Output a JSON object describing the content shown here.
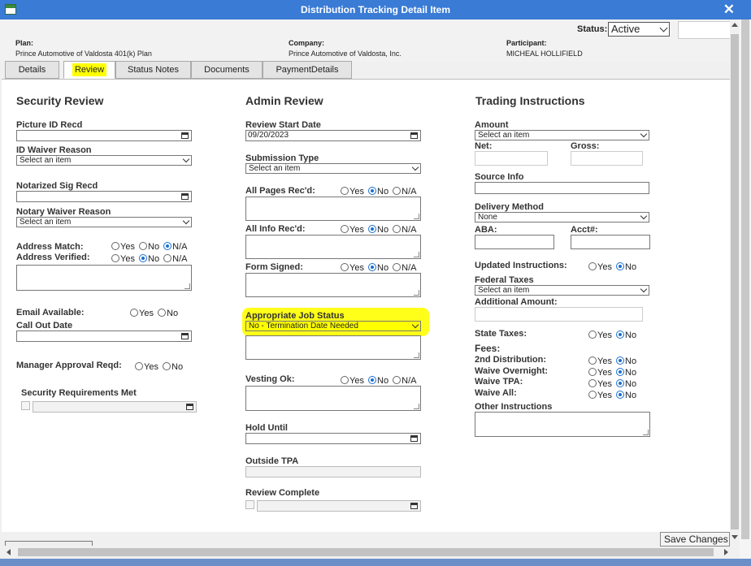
{
  "window": {
    "title": "Distribution Tracking Detail Item"
  },
  "header": {
    "plan_label": "Plan:",
    "plan_value": "Prince Automotive of Valdosta 401(k) Plan",
    "company_label": "Company:",
    "company_value": "Prince Automotive of Valdosta, Inc.",
    "participant_label": "Participant:",
    "participant_value": "MICHEAL HOLLIFIELD",
    "status_label": "Status:",
    "status_value": "Active"
  },
  "tabs": [
    {
      "label": "Details"
    },
    {
      "label": "Review"
    },
    {
      "label": "Status Notes"
    },
    {
      "label": "Documents"
    },
    {
      "label": "PaymentDetails"
    }
  ],
  "active_tab": "Review",
  "security": {
    "title": "Security Review",
    "picture_id_label": "Picture ID Recd",
    "id_waiver_label": "ID Waiver Reason",
    "id_waiver_value": "Select an item",
    "notarized_label": "Notarized Sig Recd",
    "notary_waiver_label": "Notary Waiver Reason",
    "notary_waiver_value": "Select an item",
    "address_match_label": "Address Match:",
    "address_verified_label": "Address Verified:",
    "email_label": "Email Available:",
    "callout_label": "Call Out Date",
    "manager_label": "Manager Approval Reqd:",
    "requirements_label": "Security Requirements Met"
  },
  "admin": {
    "title": "Admin Review",
    "review_start_label": "Review Start Date",
    "review_start_value": "09/20/2023",
    "submission_label": "Submission Type",
    "submission_value": "Select an item",
    "all_pages_label": "All Pages Rec'd:",
    "all_info_label": "All Info Rec'd:",
    "form_signed_label": "Form Signed:",
    "job_status_label": "Appropriate Job Status",
    "job_status_value": "No - Termination Date Needed",
    "vesting_label": "Vesting Ok:",
    "hold_until_label": "Hold Until",
    "outside_tpa_label": "Outside TPA",
    "review_complete_label": "Review Complete"
  },
  "trading": {
    "title": "Trading Instructions",
    "amount_label": "Amount",
    "amount_value": "Select an item",
    "net_label": "Net:",
    "gross_label": "Gross:",
    "source_label": "Source Info",
    "delivery_label": "Delivery Method",
    "delivery_value": "None",
    "aba_label": "ABA:",
    "acct_label": "Acct#:",
    "updated_label": "Updated Instructions:",
    "federal_label": "Federal Taxes",
    "federal_value": "Select an item",
    "additional_label": "Additional Amount:",
    "state_label": "State Taxes:",
    "fees_label": "Fees:",
    "second_dist_label": "2nd Distribution:",
    "waive_overnight_label": "Waive Overnight:",
    "waive_tpa_label": "Waive TPA:",
    "waive_all_label": "Waive All:",
    "other_label": "Other Instructions"
  },
  "options": {
    "yes": "Yes",
    "no": "No",
    "na": "N/A"
  },
  "footer": {
    "save_label": "Save Changes"
  },
  "colors": {
    "titlebar": "#3a7bd5",
    "highlight": "#ffff00",
    "radio_selected": "#1a6fd0"
  }
}
